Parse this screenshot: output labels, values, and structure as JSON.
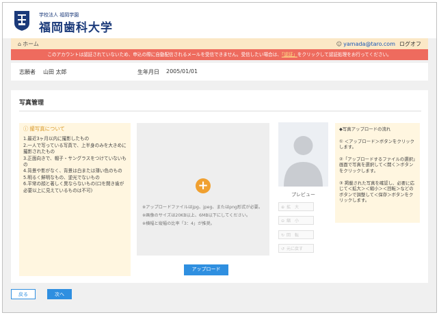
{
  "header": {
    "org_small": "学校法人 福岡学園",
    "school_name": "福岡歯科大学"
  },
  "nav": {
    "home": "ホーム",
    "email": "yamada@taro.com",
    "logout": "ログオフ"
  },
  "alert": {
    "text_before": "このアカウントは認証されていないため、申込の際に自動配信されるメールを受信できません。受信したい場合は、",
    "link": "「認証」",
    "text_after": "をクリックして認証処理をお行ってください。"
  },
  "applicant": {
    "name_label": "志願者",
    "name": "山田 太郎",
    "birth_label": "生年月日",
    "birth": "2005/01/01"
  },
  "photo": {
    "title": "写真管理",
    "guide_title": "撮写真について",
    "guide_items": [
      "1.最近3ヶ月以内に撮影したもの",
      "2.一人で写っている写真で、上半身のみを大きめに撮影されたもの",
      "3.正面向きで、帽子・サングラスをつけていないもの",
      "4.背景や影がなく、背景は白または薄い色のもの",
      "5.明るく鮮明なもの、逆光でないもの",
      "6.平常の顔と著しく異ならないもの(口を開き歯が必要以上に見えているものは不可)"
    ],
    "notes": [
      "※アップロードファイルはjpg、jpeg、またはpng形式が必要。",
      "※画像のサイズは20KB以上、6MB以下にしてください。",
      "※横幅と縦幅の比率「3：4」が推奨。"
    ],
    "upload_button": "アップロード",
    "preview_label": "プレビュー",
    "controls": [
      "拡　大",
      "縮　小",
      "回　転",
      "元に戻す"
    ],
    "flow_title": "◆写真アップロードの流れ",
    "flow_steps": [
      "① ＜アップロード＞ボタンをクリックします。",
      "②「アップロードするファイルの選択」画面で写真を選択して＜開く＞ボタンをクリックします。",
      "③ 掲載された写真を確認し、必要に応じて＜拡大＞＜縮小＞＜回転＞などのボタンで調整して＜保存＞ボタンをクリックします。"
    ]
  },
  "footer": {
    "back": "戻る",
    "next": "次へ"
  },
  "colors": {
    "accent": "#2f8fe0",
    "alert": "#ee6b5e",
    "nav_bg": "#fbe8c6",
    "guide_bg": "#fff6e0",
    "brand": "#1b3a7a"
  }
}
